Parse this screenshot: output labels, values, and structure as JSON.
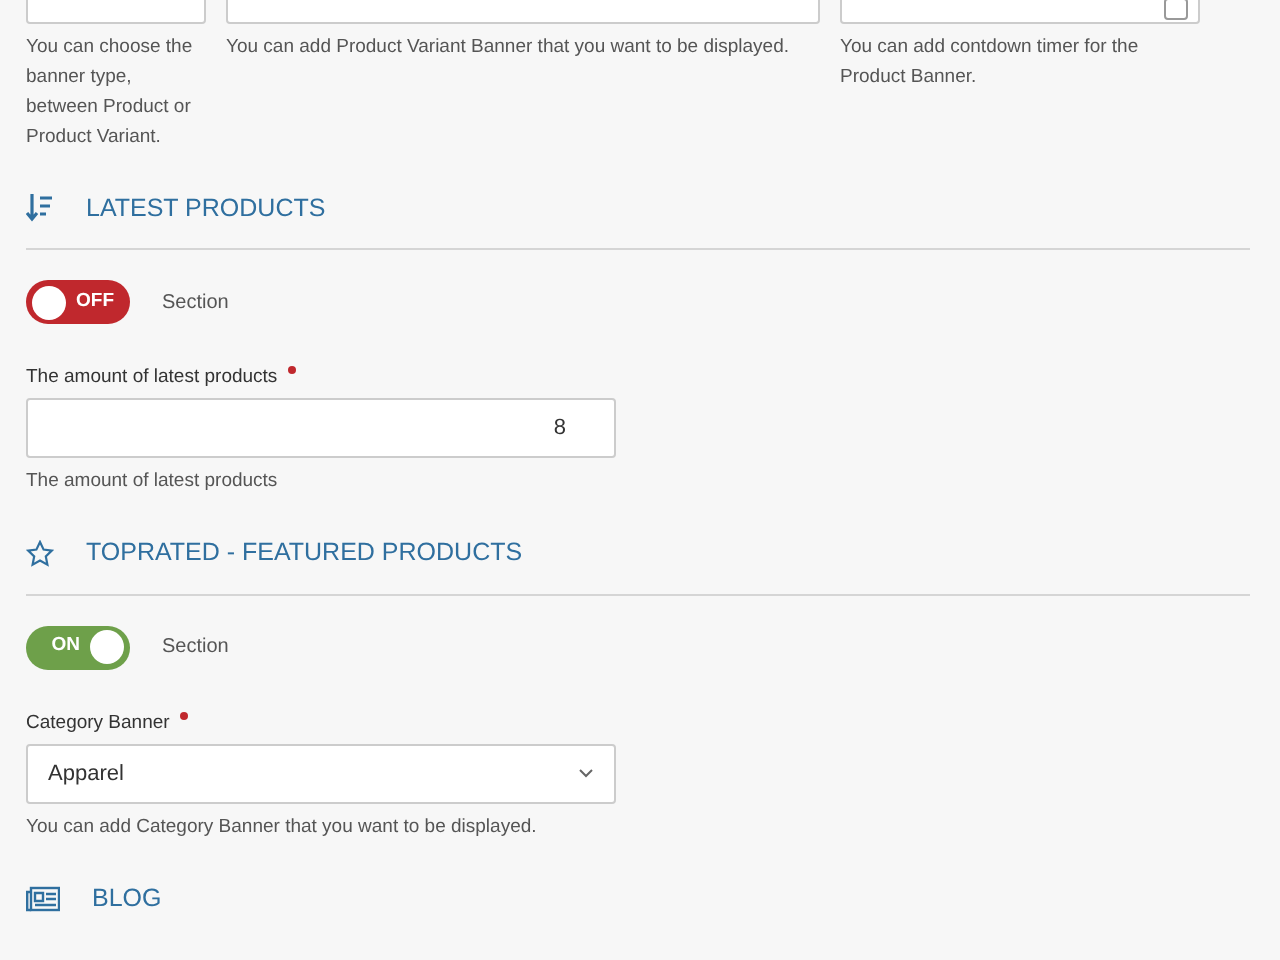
{
  "top_fields": [
    {
      "kind": "select",
      "help": "You can choose the banner type, between Product or Product Variant."
    },
    {
      "kind": "select",
      "help": "You can add Product Variant Banner that you want to be displayed."
    },
    {
      "kind": "date",
      "help": "You can add contdown timer for the Product Banner."
    }
  ],
  "sections": [
    {
      "kind": "number",
      "title": "LATEST PRODUCTS",
      "toggle": {
        "on": false,
        "text": "OFF",
        "label": "Section"
      },
      "field": {
        "label": "The amount of latest products",
        "required": true,
        "value": "8",
        "help": "The amount of latest products"
      }
    },
    {
      "kind": "select",
      "title": "TOPRATED - FEATURED PRODUCTS",
      "toggle": {
        "on": true,
        "text": "ON",
        "label": "Section"
      },
      "field": {
        "label": "Category Banner",
        "required": true,
        "value": "Apparel",
        "help": "You can add Category Banner that you want to be displayed."
      }
    },
    {
      "kind": "heading",
      "title": "BLOG"
    }
  ]
}
